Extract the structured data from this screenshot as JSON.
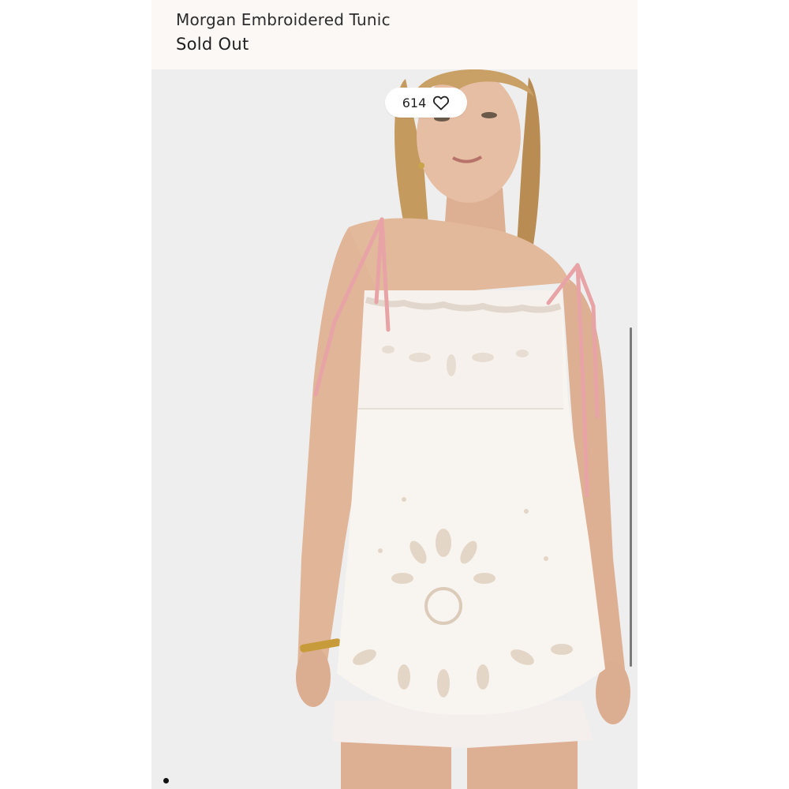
{
  "product": {
    "title": "Morgan Embroidered Tunic",
    "status": "Sold Out"
  },
  "favorites": {
    "count": "614",
    "icon": "heart-outline-icon"
  },
  "image": {
    "subject": "model-wearing-white-eyelet-tunic",
    "background_color": "#eeeeee"
  },
  "carousel": {
    "current_page": 1,
    "icon": "carousel-dot-icon"
  },
  "colors": {
    "header_bg": "#fbf8f6",
    "text": "#222222",
    "ribbon": "#e8a3a6",
    "garment": "#f8f4ef",
    "skin": "#e2b89c",
    "hair": "#c49a5e"
  }
}
